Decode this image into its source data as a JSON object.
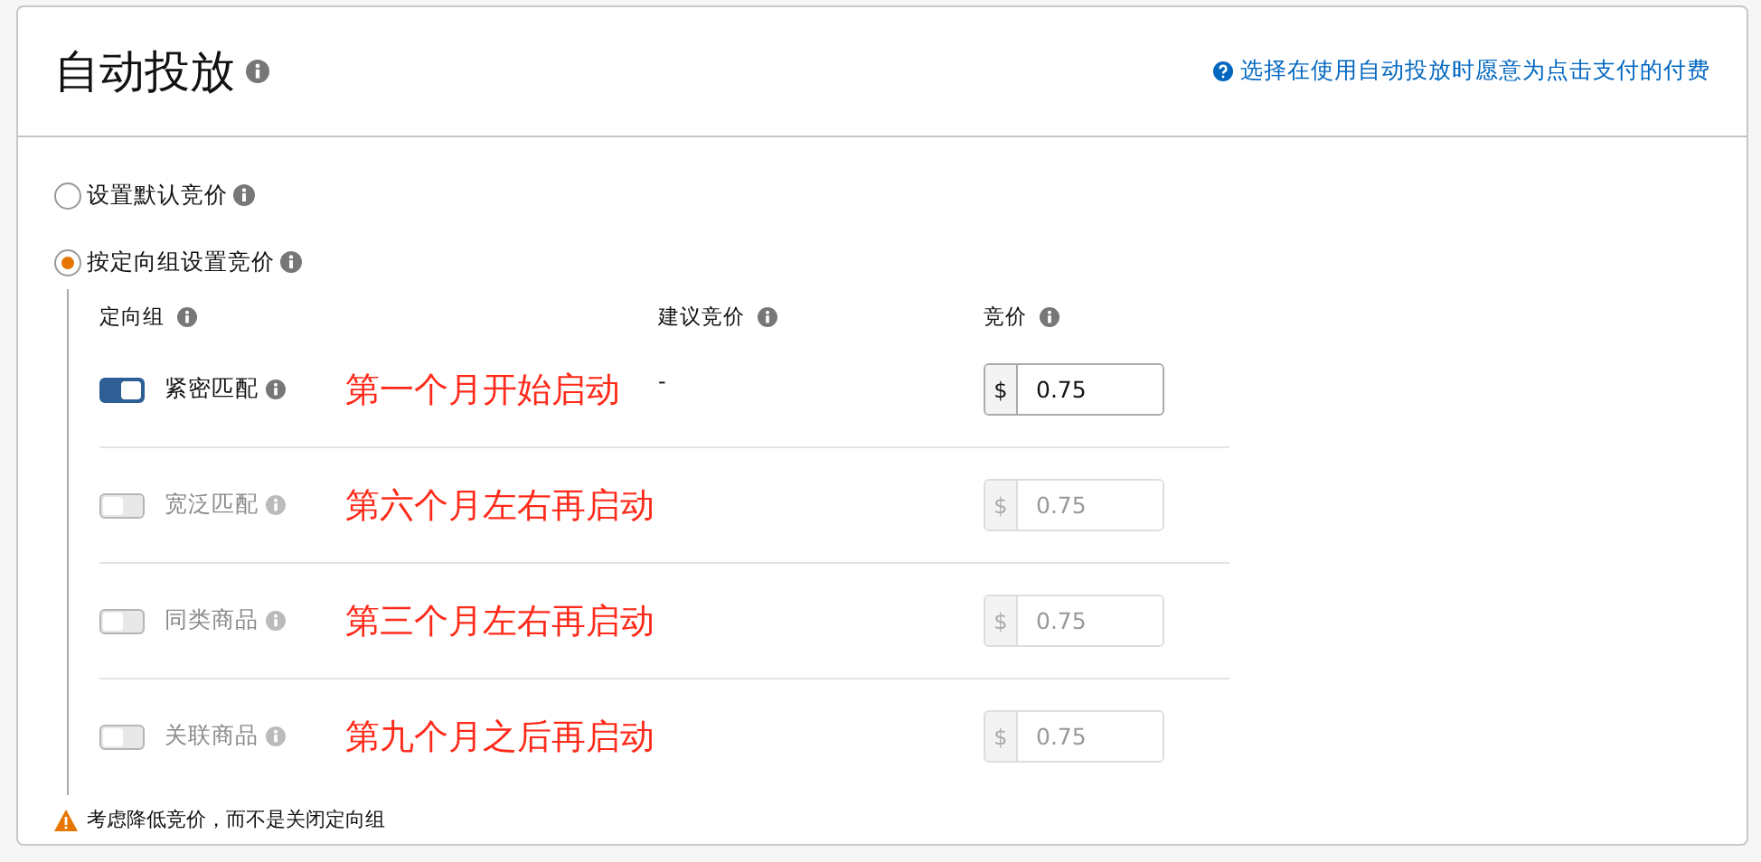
{
  "header": {
    "title": "自动投放",
    "help_link": "选择在使用自动投放时愿意为点击支付的付费"
  },
  "bid_options": [
    {
      "label": "设置默认竞价",
      "selected": false
    },
    {
      "label": "按定向组设置竞价",
      "selected": true
    }
  ],
  "table": {
    "columns": [
      "定向组",
      "建议竞价",
      "竞价"
    ],
    "rows": [
      {
        "name": "紧密匹配",
        "on": true,
        "annotation": "第一个月开始启动",
        "suggested": "-",
        "currency": "$",
        "bid": "0.75"
      },
      {
        "name": "宽泛匹配",
        "on": false,
        "annotation": "第六个月左右再启动",
        "currency": "$",
        "bid": "0.75"
      },
      {
        "name": "同类商品",
        "on": false,
        "annotation": "第三个月左右再启动",
        "currency": "$",
        "bid": "0.75"
      },
      {
        "name": "关联商品",
        "on": false,
        "annotation": "第九个月之后再启动",
        "currency": "$",
        "bid": "0.75"
      }
    ]
  },
  "warning": "考虑降低竞价，而不是关闭定向组"
}
